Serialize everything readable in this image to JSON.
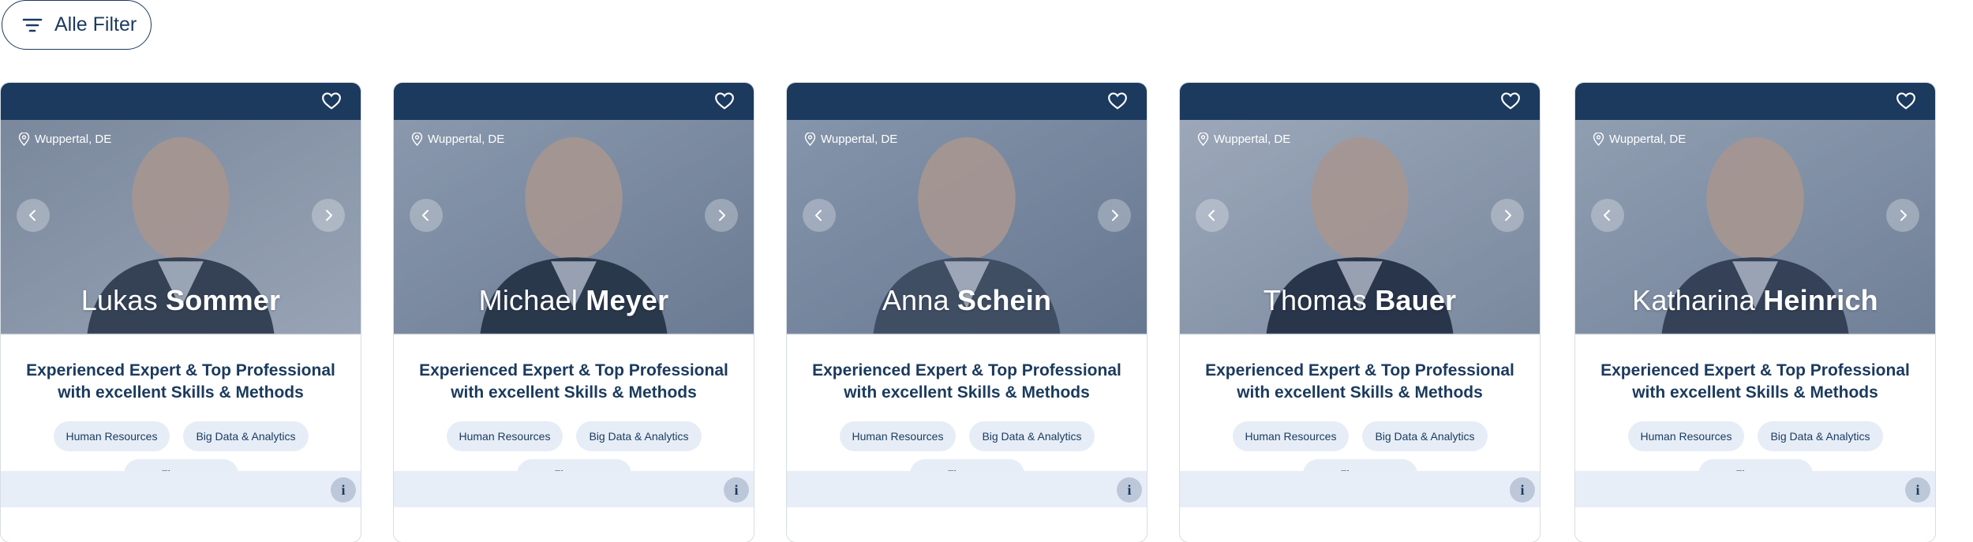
{
  "filter": {
    "label": "Alle Filter"
  },
  "cards": [
    {
      "location": "Wuppertal, DE",
      "first_name": "Lukas",
      "last_name": "Sommer",
      "title_line1": "Experienced Expert & Top Professional",
      "title_line2": "with excellent Skills & Methods",
      "tags": [
        "Human Resources",
        "Big Data & Analytics",
        "Finance"
      ],
      "photo_colors": [
        "#9aa5b4",
        "#c4ccd6",
        "#3b4552"
      ]
    },
    {
      "location": "Wuppertal, DE",
      "first_name": "Michael",
      "last_name": "Meyer",
      "title_line1": "Experienced Expert & Top Professional",
      "title_line2": "with excellent Skills & Methods",
      "tags": [
        "Human Resources",
        "Big Data & Analytics",
        "Finance"
      ],
      "photo_colors": [
        "#b0bccb",
        "#8593a6",
        "#2c3644"
      ]
    },
    {
      "location": "Wuppertal, DE",
      "first_name": "Anna",
      "last_name": "Schein",
      "title_line1": "Experienced Expert & Top Professional",
      "title_line2": "with excellent Skills & Methods",
      "tags": [
        "Human Resources",
        "Big Data & Analytics",
        "Finance"
      ],
      "photo_colors": [
        "#a9b7c8",
        "#7f8ea3",
        "#4a5566"
      ]
    },
    {
      "location": "Wuppertal, DE",
      "first_name": "Thomas",
      "last_name": "Bauer",
      "title_line1": "Experienced Expert & Top Professional",
      "title_line2": "with excellent Skills & Methods",
      "tags": [
        "Human Resources",
        "Big Data & Analytics",
        "Finance"
      ],
      "photo_colors": [
        "#c9d1dc",
        "#9aa6b6",
        "#2a3343"
      ]
    },
    {
      "location": "Wuppertal, DE",
      "first_name": "Katharina",
      "last_name": "Heinrich",
      "title_line1": "Experienced Expert & Top Professional",
      "title_line2": "with excellent Skills & Methods",
      "tags": [
        "Human Resources",
        "Big Data & Analytics",
        "Finance"
      ],
      "photo_colors": [
        "#b9c4d1",
        "#8c9aad",
        "#3a4354"
      ]
    }
  ],
  "icons": {
    "filter": "filter-icon",
    "favorite": "heart-icon",
    "location": "location-pin-icon",
    "prev": "chevron-left-icon",
    "next": "chevron-right-icon",
    "info": "info-icon"
  },
  "colors": {
    "navy": "#1c3a5e",
    "tag_bg": "#e6edf7",
    "footer_bg": "#e8eef8"
  }
}
